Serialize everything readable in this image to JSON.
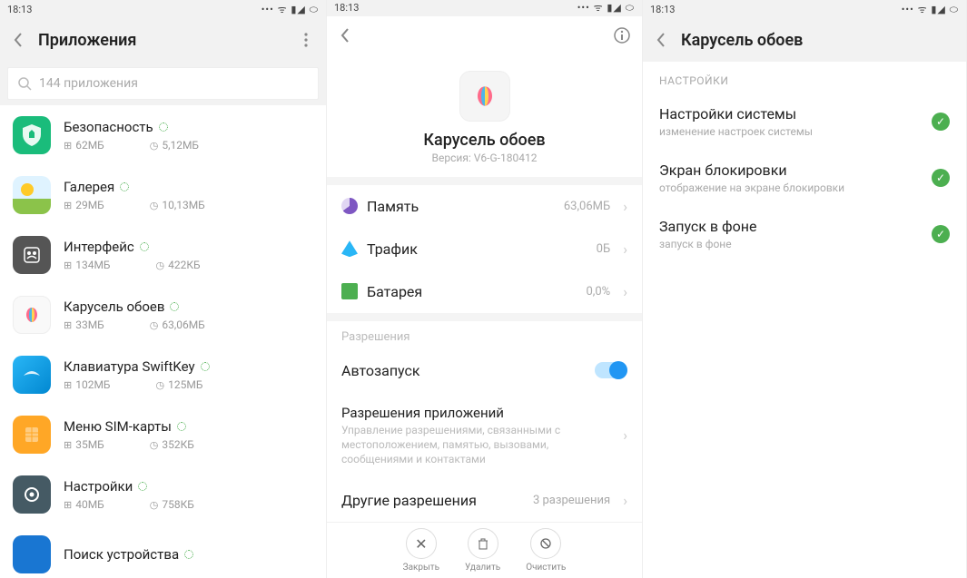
{
  "statusbar": {
    "time": "18:13"
  },
  "pane1": {
    "title": "Приложения",
    "search_placeholder": "144 приложения",
    "apps": [
      {
        "name": "Безопасность",
        "size": "62МБ",
        "disk": "5,12МБ",
        "icon": "shield"
      },
      {
        "name": "Галерея",
        "size": "29МБ",
        "disk": "10,13МБ",
        "icon": "gallery"
      },
      {
        "name": "Интерфейс",
        "size": "134МБ",
        "disk": "422КБ",
        "icon": "interface"
      },
      {
        "name": "Карусель обоев",
        "size": "33МБ",
        "disk": "63,06МБ",
        "icon": "carousel"
      },
      {
        "name": "Клавиатура SwiftKey",
        "size": "102МБ",
        "disk": "125МБ",
        "icon": "swiftkey"
      },
      {
        "name": "Меню SIM-карты",
        "size": "35МБ",
        "disk": "352КБ",
        "icon": "sim"
      },
      {
        "name": "Настройки",
        "size": "40МБ",
        "disk": "758КБ",
        "icon": "settings"
      },
      {
        "name": "Поиск устройства",
        "size": "",
        "disk": "",
        "icon": "find"
      }
    ]
  },
  "pane2": {
    "title": "Карусель обоев",
    "version": "Версия: V6-G-180412",
    "rows": {
      "memory_label": "Память",
      "memory_val": "63,06МБ",
      "traffic_label": "Трафик",
      "traffic_val": "0Б",
      "battery_label": "Батарея",
      "battery_val": "0,0%"
    },
    "perm_header": "Разрешения",
    "autostart": "Автозапуск",
    "appperms_title": "Разрешения приложений",
    "appperms_desc": "Управление разрешениями, связанными с местоположением, памятью, вызовами, сообщениями и контактами",
    "other_title": "Другие разрешения",
    "other_val": "3 разрешения",
    "bottom": {
      "close": "Закрыть",
      "delete": "Удалить",
      "clear": "Очистить"
    }
  },
  "pane3": {
    "title": "Карусель обоев",
    "group": "НАСТРОЙКИ",
    "perms": [
      {
        "title": "Настройки системы",
        "desc": "изменение настроек системы"
      },
      {
        "title": "Экран блокировки",
        "desc": "отображение на экране блокировки"
      },
      {
        "title": "Запуск в фоне",
        "desc": "запуск в фоне"
      }
    ]
  }
}
